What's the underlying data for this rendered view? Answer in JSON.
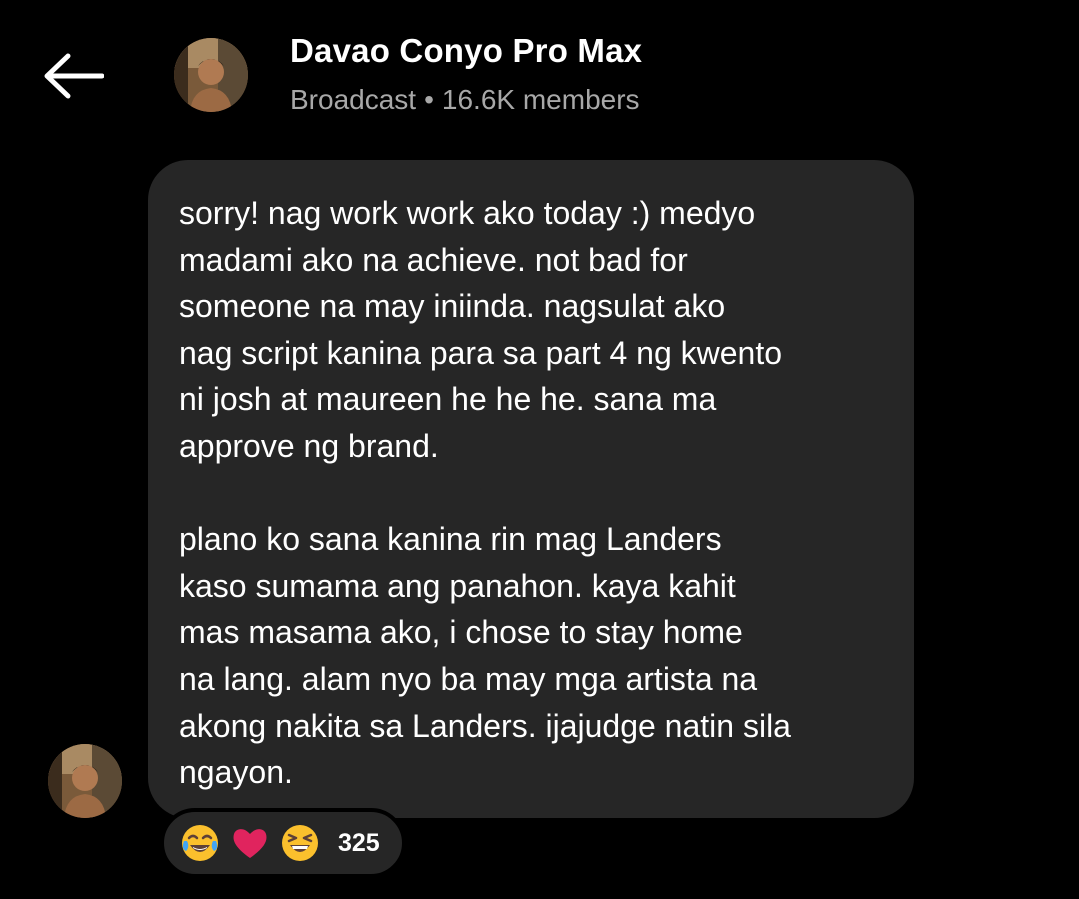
{
  "header": {
    "title": "Davao Conyo Pro Max",
    "channel_type": "Broadcast",
    "separator": "•",
    "members": "16.6K members"
  },
  "message": {
    "paragraphs": [
      "sorry! nag work work ako today :) medyo\nmadami ako na achieve. not bad for\nsomeone na may iniinda. nagsulat ako\nnag script kanina para sa part 4 ng kwento\nni josh at maureen he he he. sana ma\napprove ng brand.",
      "plano ko sana kanina rin mag Landers\nkaso sumama ang panahon. kaya kahit\nmas masama ako, i chose to stay home\nna lang. alam nyo ba may mga artista na\nakong nakita sa Landers. ijajudge natin sila\nngayon."
    ]
  },
  "reactions": {
    "emojis": [
      "face-with-tears-of-joy-icon",
      "red-heart-icon",
      "grinning-squinting-face-icon"
    ],
    "count": "325"
  },
  "colors": {
    "background": "#000000",
    "bubble": "#262626",
    "subtitle": "#a8a8a8",
    "heart": "#e0245e",
    "emoji_face": "#fbc02d"
  }
}
